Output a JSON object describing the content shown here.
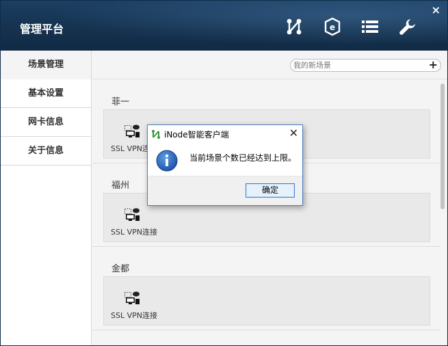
{
  "header": {
    "title": "管理平台",
    "icons": [
      "topology-icon",
      "security-shield-icon",
      "list-icon",
      "wrench-icon"
    ],
    "close_label": "×"
  },
  "sidebar": {
    "items": [
      {
        "label": "场景管理",
        "active": true
      },
      {
        "label": "基本设置",
        "active": false
      },
      {
        "label": "网卡信息",
        "active": false
      },
      {
        "label": "关于信息",
        "active": false
      }
    ]
  },
  "main": {
    "search_placeholder": "我的新场景",
    "add_label": "+",
    "scenes": [
      {
        "name": "菲一",
        "connection_label": "SSL VPN连接"
      },
      {
        "name": "福州",
        "connection_label": "SSL VPN连接"
      },
      {
        "name": "金都",
        "connection_label": "SSL VPN连接"
      }
    ]
  },
  "dialog": {
    "title": "iNode智能客户端",
    "message": "当前场景个数已经达到上限。",
    "ok_label": "确定",
    "close_label": "✕"
  },
  "colors": {
    "header_bg": "#15324f",
    "dialog_border": "#4a7fc1",
    "button_border": "#3c7fd4",
    "info_icon": "#1f5fb8"
  }
}
